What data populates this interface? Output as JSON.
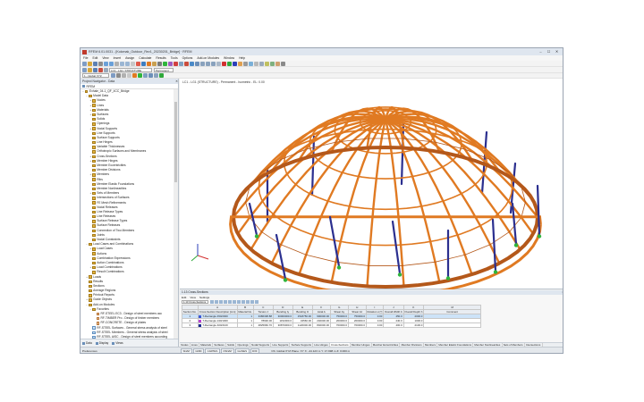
{
  "window": {
    "title": "RFEM 6.01.0031 - [Kolomak_Outdoor_Rev1_20230201_Bridge] · RFEM",
    "minimize": "–",
    "maximize": "☐",
    "close": "✕"
  },
  "menubar": [
    "File",
    "Edit",
    "View",
    "Insert",
    "Assign",
    "Calculate",
    "Results",
    "Tools",
    "Options",
    "Add-on Modules",
    "Window",
    "Help"
  ],
  "toolbar": {
    "loadcase_combo": "LC1 - LG1: STRUCTURE",
    "action_combo": "Permanent",
    "view_combo": "1 - Global XYZ"
  },
  "navigator": {
    "title": "Project Navigator - Data",
    "search": "RFEM",
    "items": [
      {
        "label": "Exhale_04-1_QF_4CC_Bridge",
        "expand": "−",
        "level": 0
      },
      {
        "label": "Model Data",
        "expand": "−",
        "level": 1
      },
      {
        "label": "Nodes",
        "expand": "+",
        "level": 2
      },
      {
        "label": "Lines",
        "expand": "+",
        "level": 2
      },
      {
        "label": "Materials",
        "expand": "+",
        "level": 2
      },
      {
        "label": "Surfaces",
        "expand": "+",
        "level": 2
      },
      {
        "label": "Solids",
        "expand": "",
        "level": 2
      },
      {
        "label": "Openings",
        "expand": "",
        "level": 2
      },
      {
        "label": "Nodal Supports",
        "expand": "+",
        "level": 2
      },
      {
        "label": "Line Supports",
        "expand": "",
        "level": 2
      },
      {
        "label": "Surface Supports",
        "expand": "",
        "level": 2
      },
      {
        "label": "Line Hinges",
        "expand": "",
        "level": 2
      },
      {
        "label": "Variable Thicknesses",
        "expand": "",
        "level": 2
      },
      {
        "label": "Orthotropic Surfaces and Membranes",
        "expand": "",
        "level": 2
      },
      {
        "label": "Cross-Sections",
        "expand": "+",
        "level": 2
      },
      {
        "label": "Member Hinges",
        "expand": "+",
        "level": 2
      },
      {
        "label": "Member Eccentricities",
        "expand": "",
        "level": 2
      },
      {
        "label": "Member Divisions",
        "expand": "",
        "level": 2
      },
      {
        "label": "Members",
        "expand": "+",
        "level": 2
      },
      {
        "label": "Ribs",
        "expand": "",
        "level": 2
      },
      {
        "label": "Member Elastic Foundations",
        "expand": "",
        "level": 2
      },
      {
        "label": "Member Nonlinearities",
        "expand": "",
        "level": 2
      },
      {
        "label": "Sets of Members",
        "expand": "+",
        "level": 2
      },
      {
        "label": "Intersections of Surfaces",
        "expand": "",
        "level": 2
      },
      {
        "label": "FE Mesh Refinements",
        "expand": "",
        "level": 2
      },
      {
        "label": "Nodal Releases",
        "expand": "",
        "level": 2
      },
      {
        "label": "Line Release Types",
        "expand": "",
        "level": 2
      },
      {
        "label": "Line Releases",
        "expand": "",
        "level": 2
      },
      {
        "label": "Surface Release Types",
        "expand": "",
        "level": 2
      },
      {
        "label": "Surface Releases",
        "expand": "",
        "level": 2
      },
      {
        "label": "Connection of Two Members",
        "expand": "",
        "level": 2
      },
      {
        "label": "Joints",
        "expand": "",
        "level": 2
      },
      {
        "label": "Nodal Constraints",
        "expand": "",
        "level": 2
      },
      {
        "label": "Load Cases and Combinations",
        "expand": "−",
        "level": 1
      },
      {
        "label": "Load Cases",
        "expand": "+",
        "level": 2
      },
      {
        "label": "Actions",
        "expand": "",
        "level": 2
      },
      {
        "label": "Combination Expressions",
        "expand": "",
        "level": 2
      },
      {
        "label": "Action Combinations",
        "expand": "",
        "level": 2
      },
      {
        "label": "Load Combinations",
        "expand": "+",
        "level": 2
      },
      {
        "label": "Result Combinations",
        "expand": "",
        "level": 2
      },
      {
        "label": "Loads",
        "expand": "+",
        "level": 1
      },
      {
        "label": "Results",
        "expand": "",
        "level": 1
      },
      {
        "label": "Sections",
        "expand": "",
        "level": 1
      },
      {
        "label": "Average Regions",
        "expand": "",
        "level": 1
      },
      {
        "label": "Printout Reports",
        "expand": "",
        "level": 1
      },
      {
        "label": "Guide Objects",
        "expand": "+",
        "level": 1
      },
      {
        "label": "Add-on Modules",
        "expand": "−",
        "level": 1
      },
      {
        "label": "Favorites",
        "expand": "−",
        "level": 2
      },
      {
        "label": "RF-STEEL EC3 - Design of steel members acc",
        "expand": "",
        "level": 3,
        "kind": "add"
      },
      {
        "label": "RF-TIMBER Pro - Design of timber members",
        "expand": "",
        "level": 3,
        "kind": "add"
      },
      {
        "label": "RF-CONCRETE - Design of plates",
        "expand": "",
        "level": 3,
        "kind": "add"
      },
      {
        "label": "RF-STEEL Surfaces - General stress analysis of steel",
        "expand": "",
        "level": 2,
        "kind": "res"
      },
      {
        "label": "RF-STEEL Members - General stress analysis of steel",
        "expand": "",
        "level": 2,
        "kind": "res"
      },
      {
        "label": "RF-STEEL AISC - Design of steel members according",
        "expand": "",
        "level": 2,
        "kind": "res"
      },
      {
        "label": "RF-STEEL SIA - Design of steel members according to",
        "expand": "",
        "level": 2,
        "kind": "res"
      }
    ],
    "tabs": [
      "Data",
      "Display",
      "Views"
    ]
  },
  "viewport": {
    "header": "LC1 - LG1 (STRUCTURE) - Permanent - Isometric - EL: 0.00"
  },
  "table": {
    "title": "1.13 Cross-Sections",
    "menu": [
      "Edit",
      "View",
      "Settings"
    ],
    "combo": "1.13 Cross-Sections",
    "group_headers": [
      "A",
      "B",
      "C",
      "D",
      "E",
      "F",
      "G",
      "H",
      "I",
      "J",
      "K",
      "L",
      "M"
    ],
    "headers": [
      "Section No.",
      "Cross-Section Description [mm]",
      "Material No.",
      "Torsion J",
      "Bending Iy",
      "Bending Iz",
      "Axial A",
      "Shear Ay",
      "Shear Az",
      "Rotation α [°]",
      "Overall Width b",
      "Overall Depth h",
      "Comment"
    ],
    "rows": [
      {
        "no": "1",
        "color": "#3a57d6",
        "desc": "T-Rectangle 450/2000",
        "mat": "1",
        "torsion": "3386338.88",
        "iy": "30000000.0",
        "iz": "1518750.00",
        "a": "900000.00",
        "ay": "750000.0",
        "az": "750000.0",
        "rot": "0.00",
        "b": "450.0",
        "h": "2000.0",
        "comment": ""
      },
      {
        "no": "2",
        "color": "#b83fd2",
        "desc": "T-Rectangle 240/1000",
        "mat": "1",
        "torsion": "78930.00",
        "iy": "1152000.0",
        "iz": "34560.00",
        "a": "240000.00",
        "ay": "200000.0",
        "az": "200000.0",
        "rot": "0.00",
        "b": "240.0",
        "h": "1000.0",
        "comment": ""
      },
      {
        "no": "3",
        "color": "#1b2a8f",
        "desc": "T-Rectangle 400/2100",
        "mat": "1",
        "torsion": "4825960.70",
        "iy": "30870000.0",
        "iz": "1120000.00",
        "a": "840000.00",
        "ay": "700000.0",
        "az": "700000.0",
        "rot": "0.00",
        "b": "400.0",
        "h": "2100.0",
        "comment": ""
      }
    ],
    "sheets": [
      "Nodes",
      "Lines",
      "Materials",
      "Surfaces",
      "Solids",
      "Openings",
      "Nodal Supports",
      "Line Supports",
      "Surface Supports",
      "Line Hinges",
      "Cross-Sections",
      "Member Hinges",
      "Member Eccentricities",
      "Member Divisions",
      "Members",
      "Member Elastic Foundations",
      "Member Nonlinearities",
      "Sets of Members",
      "Intersections"
    ]
  },
  "statusbar": {
    "left": "Preferences",
    "snaps": [
      "SNAP",
      "GRID",
      "CARTES",
      "OSNAP",
      "GLINES",
      "DXF"
    ],
    "right": "CS: Global XYZ    Plane: XY        X: -44.123 m    Y: 17.998 m    Z: 0.000 m"
  },
  "colors": {
    "timber": "#e07a22",
    "timber_dark": "#b4581a",
    "columns": "#2b2f8f",
    "supports": "#2fb53c",
    "axis_x": "#d23030",
    "axis_y": "#2fa83a",
    "axis_z": "#2b3fb8"
  }
}
